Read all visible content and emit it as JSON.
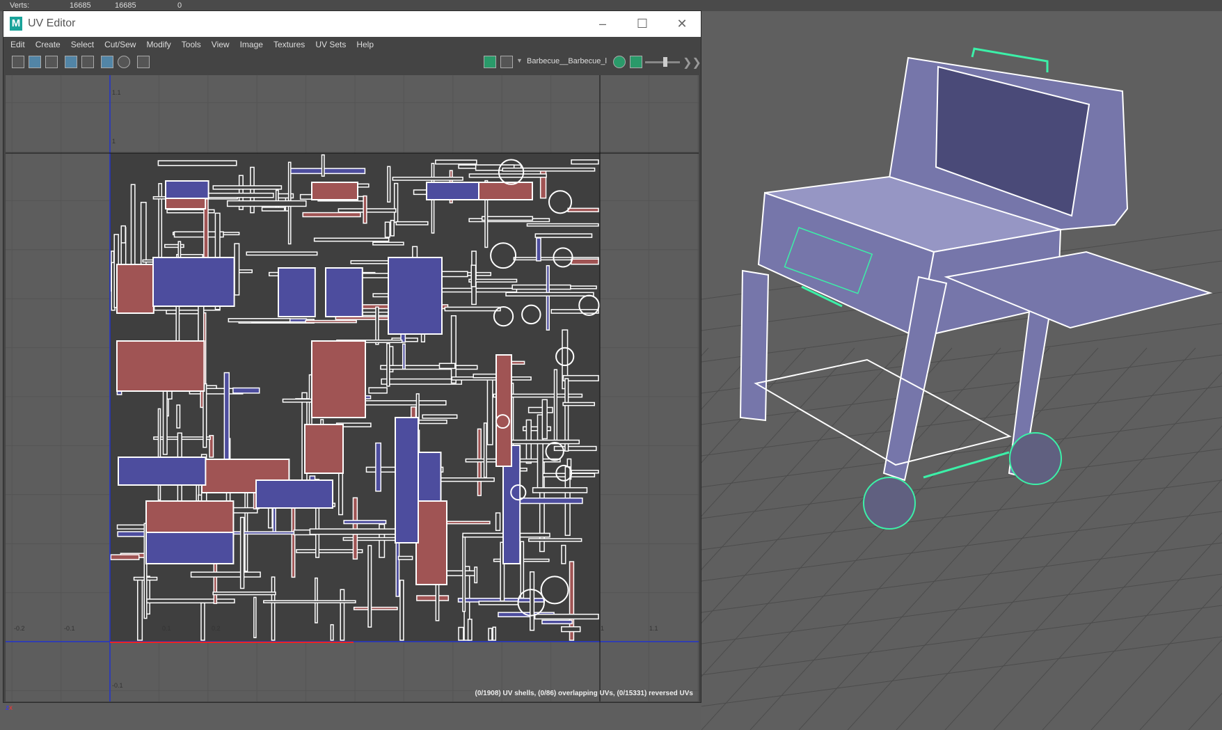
{
  "hud": {
    "label": "Verts:",
    "values": [
      "16685",
      "16685",
      "0"
    ]
  },
  "window": {
    "title": "UV Editor",
    "logo": "M",
    "controls": [
      "minimize",
      "maximize",
      "close"
    ]
  },
  "menu": [
    "Edit",
    "Create",
    "Select",
    "Cut/Sew",
    "Modify",
    "Tools",
    "View",
    "Image",
    "Textures",
    "UV Sets",
    "Help"
  ],
  "toolbar": {
    "texture_name": "Barbecue__Barbecue_l"
  },
  "uv_axes": {
    "u_ticks": [
      "-0.2",
      "-0.1",
      "0.1",
      "0.2",
      "1",
      "1.1"
    ],
    "v_ticks": [
      "1.1",
      "1",
      "-0.1"
    ]
  },
  "status": "(0/1908) UV shells, (0/86) overlapping UVs, (0/15331) reversed UVs",
  "viewport": {
    "camera": "persp"
  },
  "colors": {
    "uv_red": "#a05454",
    "uv_blue": "#4d4d9e",
    "wire": "#3cf0a8",
    "mesh": "#7d7db0"
  }
}
